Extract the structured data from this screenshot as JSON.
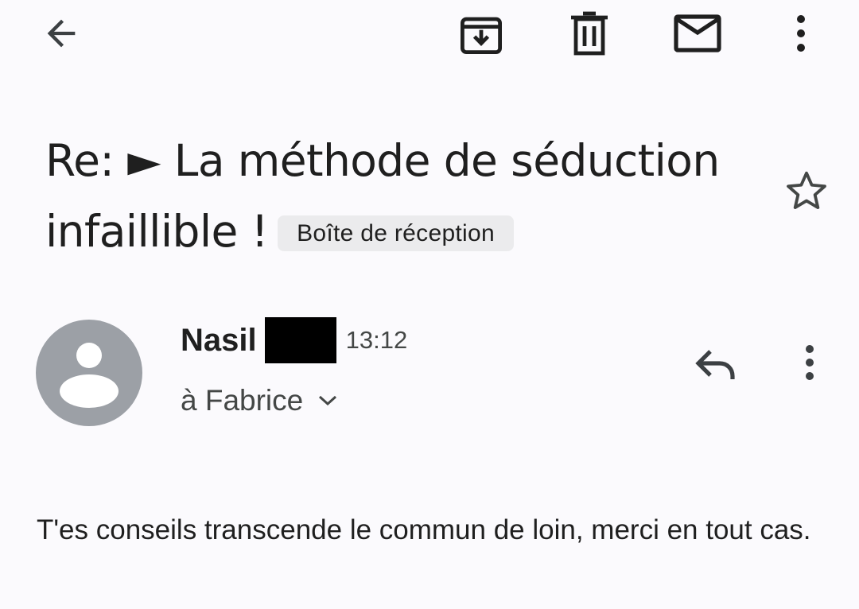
{
  "toolbar": {
    "icons": [
      "back-arrow-icon",
      "archive-icon",
      "trash-icon",
      "mail-icon",
      "more-vert-icon"
    ]
  },
  "email": {
    "subject_line1": "Re: ► La méthode de séduction",
    "subject_line2": "infaillible !",
    "label": "Boîte de réception",
    "sender_name": "Nasil",
    "time": "13:12",
    "recipient": "à Fabrice",
    "body": "T'es conseils transcende le commun de loin, merci en tout cas."
  },
  "colors": {
    "background": "#fbfafd",
    "text_primary": "#1f1f1f",
    "text_secondary": "#444746",
    "avatar_bg": "#9ca0a6",
    "chip_bg": "#ebebed"
  }
}
